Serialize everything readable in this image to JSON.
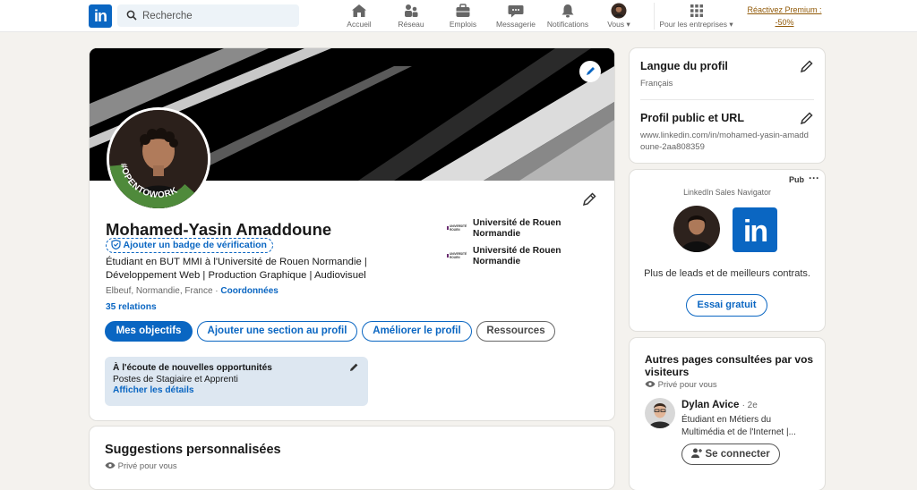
{
  "colors": {
    "brand": "#0a66c2",
    "premium": "#915907",
    "otw_green": "#4f8a3b"
  },
  "topbar": {
    "logo": "in",
    "search_placeholder": "Recherche",
    "nav": [
      {
        "label": "Accueil",
        "icon": "home-icon"
      },
      {
        "label": "Réseau",
        "icon": "network-icon"
      },
      {
        "label": "Emplois",
        "icon": "briefcase-icon"
      },
      {
        "label": "Messagerie",
        "icon": "message-icon"
      },
      {
        "label": "Notifications",
        "icon": "bell-icon"
      },
      {
        "label": "Vous",
        "icon": "avatar-icon"
      },
      {
        "label": "Pour les entreprises",
        "icon": "grid-icon"
      }
    ],
    "premium": "Réactivez Premium : -50%"
  },
  "profile": {
    "opentowork": "#OPENTOWORK",
    "name": "Mohamed-Yasin Amaddoune",
    "badge": "Ajouter un badge de vérification",
    "headline": "Étudiant en BUT MMI à l'Université de Rouen Normandie | Développement Web | Production Graphique | Audiovisuel",
    "location": "Elbeuf, Normandie, France ·",
    "contact": "Coordonnées",
    "relations": "35 relations",
    "schools": [
      "Université de Rouen Normandie",
      "Université de Rouen Normandie"
    ],
    "buttons": {
      "goals": "Mes objectifs",
      "add_section": "Ajouter une section au profil",
      "improve": "Améliorer le profil",
      "resources": "Ressources"
    },
    "open_to_work": {
      "title": "À l'écoute de nouvelles opportunités",
      "roles": "Postes de Stagiaire et Apprenti",
      "details": "Afficher les détails"
    }
  },
  "suggestions": {
    "title": "Suggestions personnalisées",
    "private": "Privé pour vous"
  },
  "sidebar": {
    "language": {
      "title": "Langue du profil",
      "value": "Français"
    },
    "public_profile": {
      "title": "Profil public et URL",
      "url": "www.linkedin.com/in/mohamed-yasin-amaddoune-2aa808359"
    },
    "ad": {
      "tag": "Pub",
      "sponsor": "LinkedIn Sales Navigator",
      "text": "Plus de leads et de meilleurs contrats.",
      "cta": "Essai gratuit"
    },
    "viewed": {
      "title": "Autres pages consultées par vos visiteurs",
      "private": "Privé pour vous",
      "person": {
        "name": "Dylan Avice",
        "degree": "· 2e",
        "headline": "Étudiant en Métiers du Multimédia et de l'Internet |...",
        "connect": "Se connecter"
      }
    }
  }
}
